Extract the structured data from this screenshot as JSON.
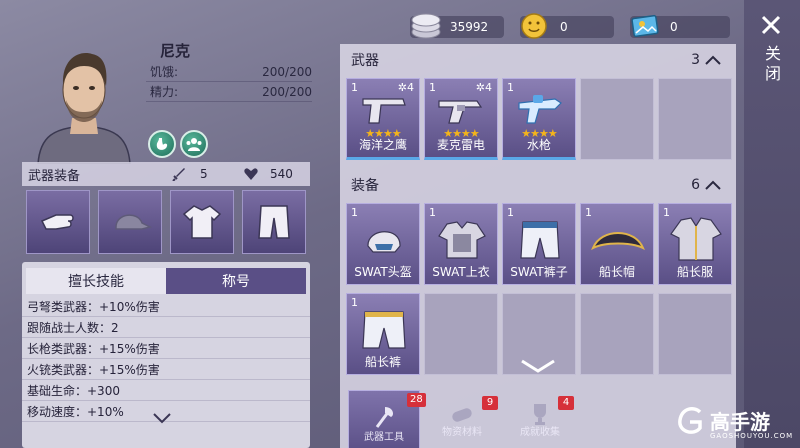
{
  "character": {
    "name": "尼克",
    "stats": [
      {
        "label": "饥饿:",
        "value": "200/200"
      },
      {
        "label": "精力:",
        "value": "200/200"
      }
    ]
  },
  "equip_bar": {
    "label": "武器装备",
    "attack": "5",
    "health": "540"
  },
  "skills": {
    "tabs": [
      {
        "label": "擅长技能",
        "active": false
      },
      {
        "label": "称号",
        "active": true
      }
    ],
    "lines": [
      "弓弩类武器：+10%伤害",
      "跟随战士人数：2",
      "长枪类武器：+15%伤害",
      "火铳类武器：+15%伤害",
      "基础生命：+300",
      "移动速度：+10%"
    ]
  },
  "resources": {
    "coins": "35992",
    "gems": "0",
    "tickets": "0"
  },
  "close": {
    "label": "关闭"
  },
  "weapons": {
    "title": "武器",
    "count": "3",
    "items": [
      {
        "qty": "1",
        "level": "4",
        "stars": "★★★★",
        "name": "海洋之鹰"
      },
      {
        "qty": "1",
        "level": "4",
        "stars": "★★★★",
        "name": "麦克雷电"
      },
      {
        "qty": "1",
        "level": "",
        "stars": "★★★★",
        "name": "水枪"
      }
    ]
  },
  "equipment": {
    "title": "装备",
    "count": "6",
    "items": [
      {
        "qty": "1",
        "name": "SWAT头盔"
      },
      {
        "qty": "1",
        "name": "SWAT上衣"
      },
      {
        "qty": "1",
        "name": "SWAT裤子"
      },
      {
        "qty": "1",
        "name": "船长帽"
      },
      {
        "qty": "1",
        "name": "船长服"
      },
      {
        "qty": "1",
        "name": "船长裤"
      }
    ]
  },
  "bottom_tabs": [
    {
      "label": "武器工具",
      "count": "28",
      "active": true
    },
    {
      "label": "物资材料",
      "count": "9",
      "active": false
    },
    {
      "label": "成就收集",
      "count": "4",
      "active": false
    }
  ],
  "logo": {
    "name": "高手游",
    "domain": "GAOSHOUYOU.COM"
  }
}
